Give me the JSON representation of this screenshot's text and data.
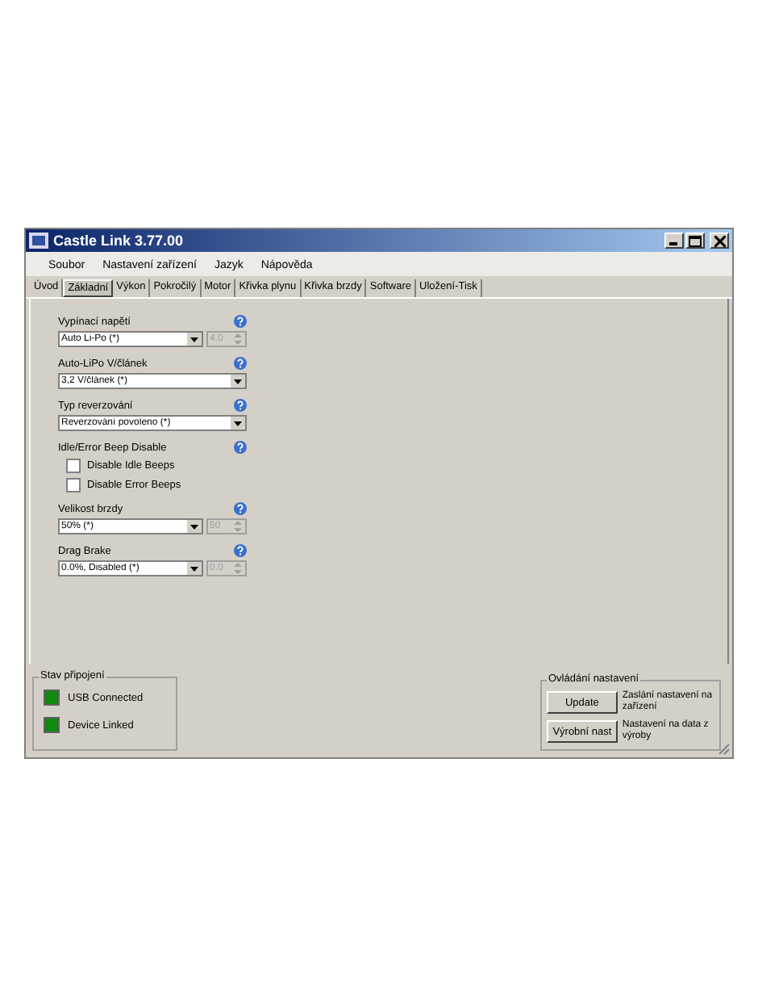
{
  "window": {
    "title": "Castle Link 3.77.00"
  },
  "menu": [
    "Soubor",
    "Nastavení zařízení",
    "Jazyk",
    "Nápověda"
  ],
  "tabs": [
    {
      "label": "Úvod",
      "selected": false
    },
    {
      "label": "Základní",
      "selected": true
    },
    {
      "label": "Výkon",
      "selected": false
    },
    {
      "label": "Pokročilý",
      "selected": false
    },
    {
      "label": "Motor",
      "selected": false
    },
    {
      "label": "Křivka plynu",
      "selected": false
    },
    {
      "label": "Křivka brzdy",
      "selected": false
    },
    {
      "label": "Software",
      "selected": false
    },
    {
      "label": "Uložení-Tisk",
      "selected": false
    }
  ],
  "settings": [
    {
      "kind": "combo_spin",
      "label": "Vypínací napětí",
      "value": "Auto Li-Po (*)",
      "spin_value": "4.0",
      "spin_disabled": true
    },
    {
      "kind": "combo",
      "label": "Auto-LiPo V/článek",
      "value": "3,2 V/článek (*)"
    },
    {
      "kind": "combo",
      "label": "Typ reverzování",
      "value": "Reverzování povoleno (*)"
    },
    {
      "kind": "checks",
      "label": "Idle/Error Beep Disable",
      "options": [
        {
          "label": "Disable Idle Beeps",
          "checked": false
        },
        {
          "label": "Disable Error Beeps",
          "checked": false
        }
      ]
    },
    {
      "kind": "combo_spin",
      "label": "Velikost brzdy",
      "value": "50% (*)",
      "spin_value": "50",
      "spin_disabled": true
    },
    {
      "kind": "combo_spin",
      "label": "Drag Brake",
      "value": "0.0%, Disabled (*)",
      "spin_value": "0.0",
      "spin_disabled": true
    }
  ],
  "connection": {
    "title": "Stav připojení",
    "indicators": [
      {
        "label": "USB Connected",
        "color": "#108a10"
      },
      {
        "label": "Device Linked",
        "color": "#108a10"
      }
    ]
  },
  "controls": {
    "title": "Ovládání nastavení",
    "actions": [
      {
        "button": "Update",
        "description": "Zaslání nastavení na zařízení"
      },
      {
        "button": "Výrobní nast",
        "description": "Nastavení na data z výroby"
      }
    ]
  }
}
